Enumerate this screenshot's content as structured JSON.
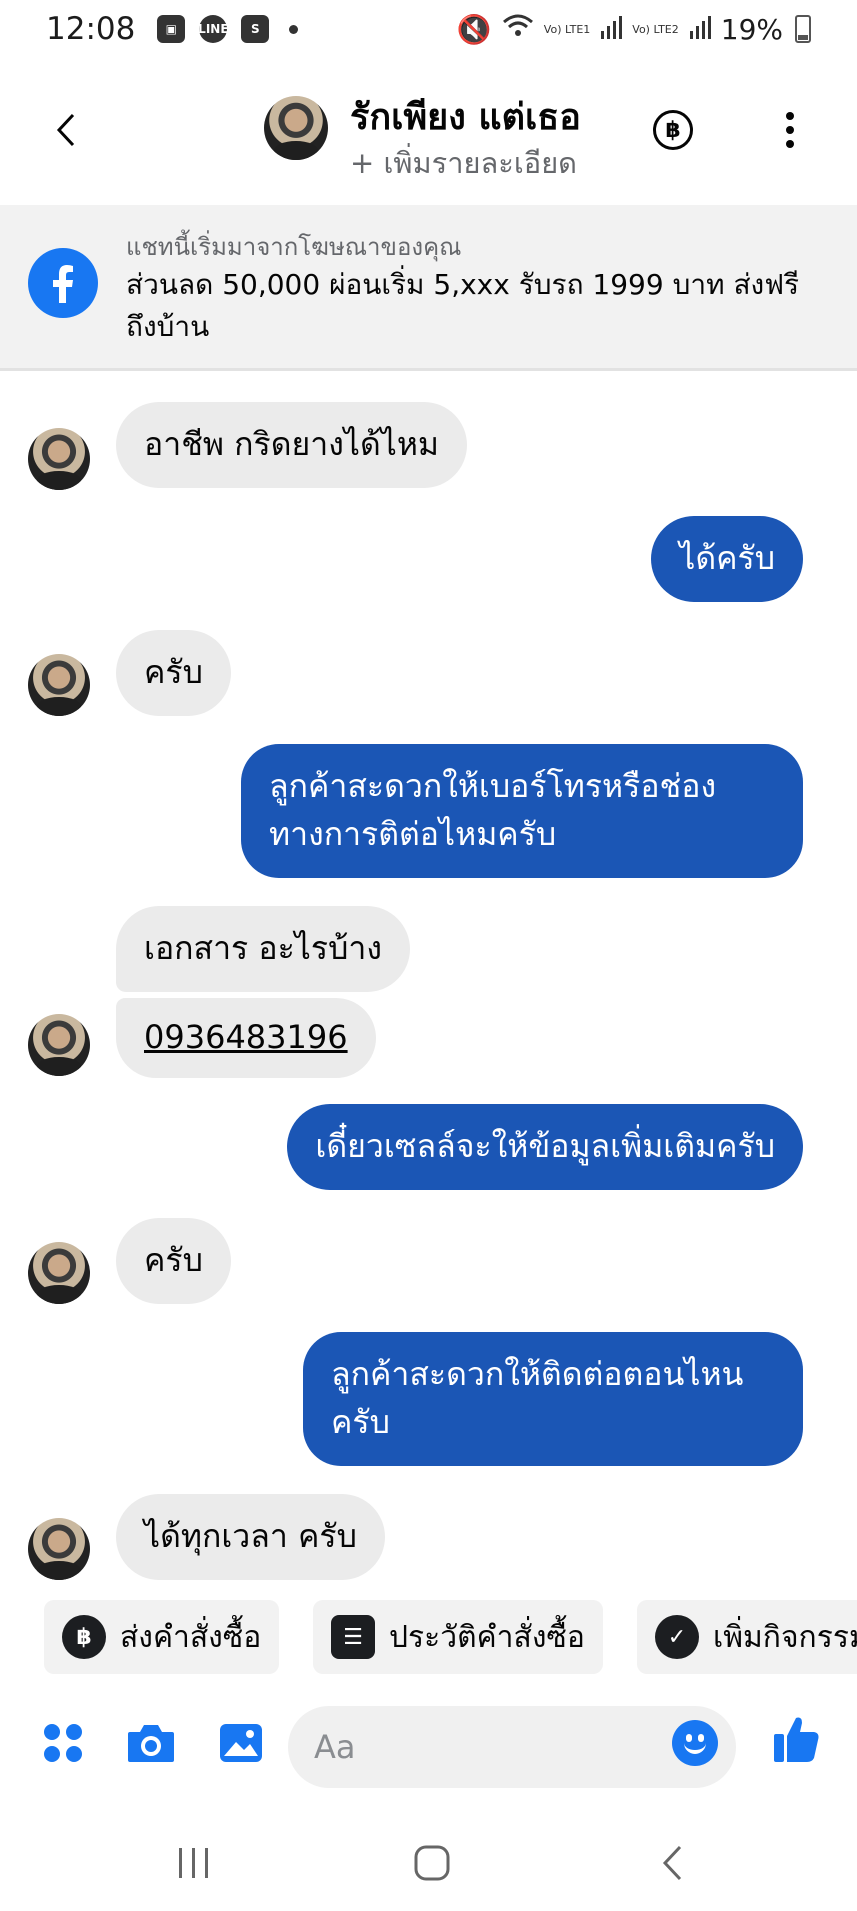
{
  "status_bar": {
    "time": "12:08",
    "notif_icons": [
      "image-icon",
      "line-icon",
      "shop-icon"
    ],
    "network1": "Vo) LTE1",
    "network2": "Vo) LTE2",
    "battery": "19%"
  },
  "header": {
    "name": "รักเพียง แต่เธอ",
    "subtitle": "+ เพิ่มรายละเอียด",
    "baht_symbol": "฿"
  },
  "ad_banner": {
    "caption": "แชทนี้เริ่มมาจากโฆษณาของคุณ",
    "text": "ส่วนลด 50,000 ผ่อนเริ่ม 5,xxx รับรถ 1999 บาท ส่งฟรีถึงบ้าน"
  },
  "messages": [
    {
      "direction": "incoming",
      "text": "อาชีพ กริดยางได้ไหม"
    },
    {
      "direction": "outgoing",
      "text": "ได้ครับ"
    },
    {
      "direction": "incoming",
      "text": "ครับ"
    },
    {
      "direction": "outgoing",
      "text": "ลูกค้าสะดวกให้เบอร์โทรหรือช่องทางการติต่อไหมครับ"
    },
    {
      "direction": "incoming",
      "text": "เอกสาร อะไรบ้าง"
    },
    {
      "direction": "incoming",
      "text": "0936483196"
    },
    {
      "direction": "outgoing",
      "text": "เดี๋ยวเซลล์จะให้ข้อมูลเพิ่มเติมครับ"
    },
    {
      "direction": "incoming",
      "text": "ครับ"
    },
    {
      "direction": "outgoing",
      "text": "ลูกค้าสะดวกให้ติดต่อตอนไหนครับ"
    },
    {
      "direction": "incoming",
      "text": "ได้ทุกเวลา ครับ"
    }
  ],
  "quick_actions": [
    {
      "label": "ส่งคำสั่งซื้อ",
      "icon": "baht-icon",
      "glyph": "฿"
    },
    {
      "label": "ประวัติคำสั่งซื้อ",
      "icon": "list-icon",
      "glyph": "☰"
    },
    {
      "label": "เพิ่มกิจกรรม",
      "icon": "check-icon",
      "glyph": "✓"
    }
  ],
  "composer": {
    "placeholder": "Aa"
  },
  "colors": {
    "accent": "#1877f2",
    "outgoing_bubble": "#1b56b5",
    "incoming_bubble": "#ebebeb"
  }
}
